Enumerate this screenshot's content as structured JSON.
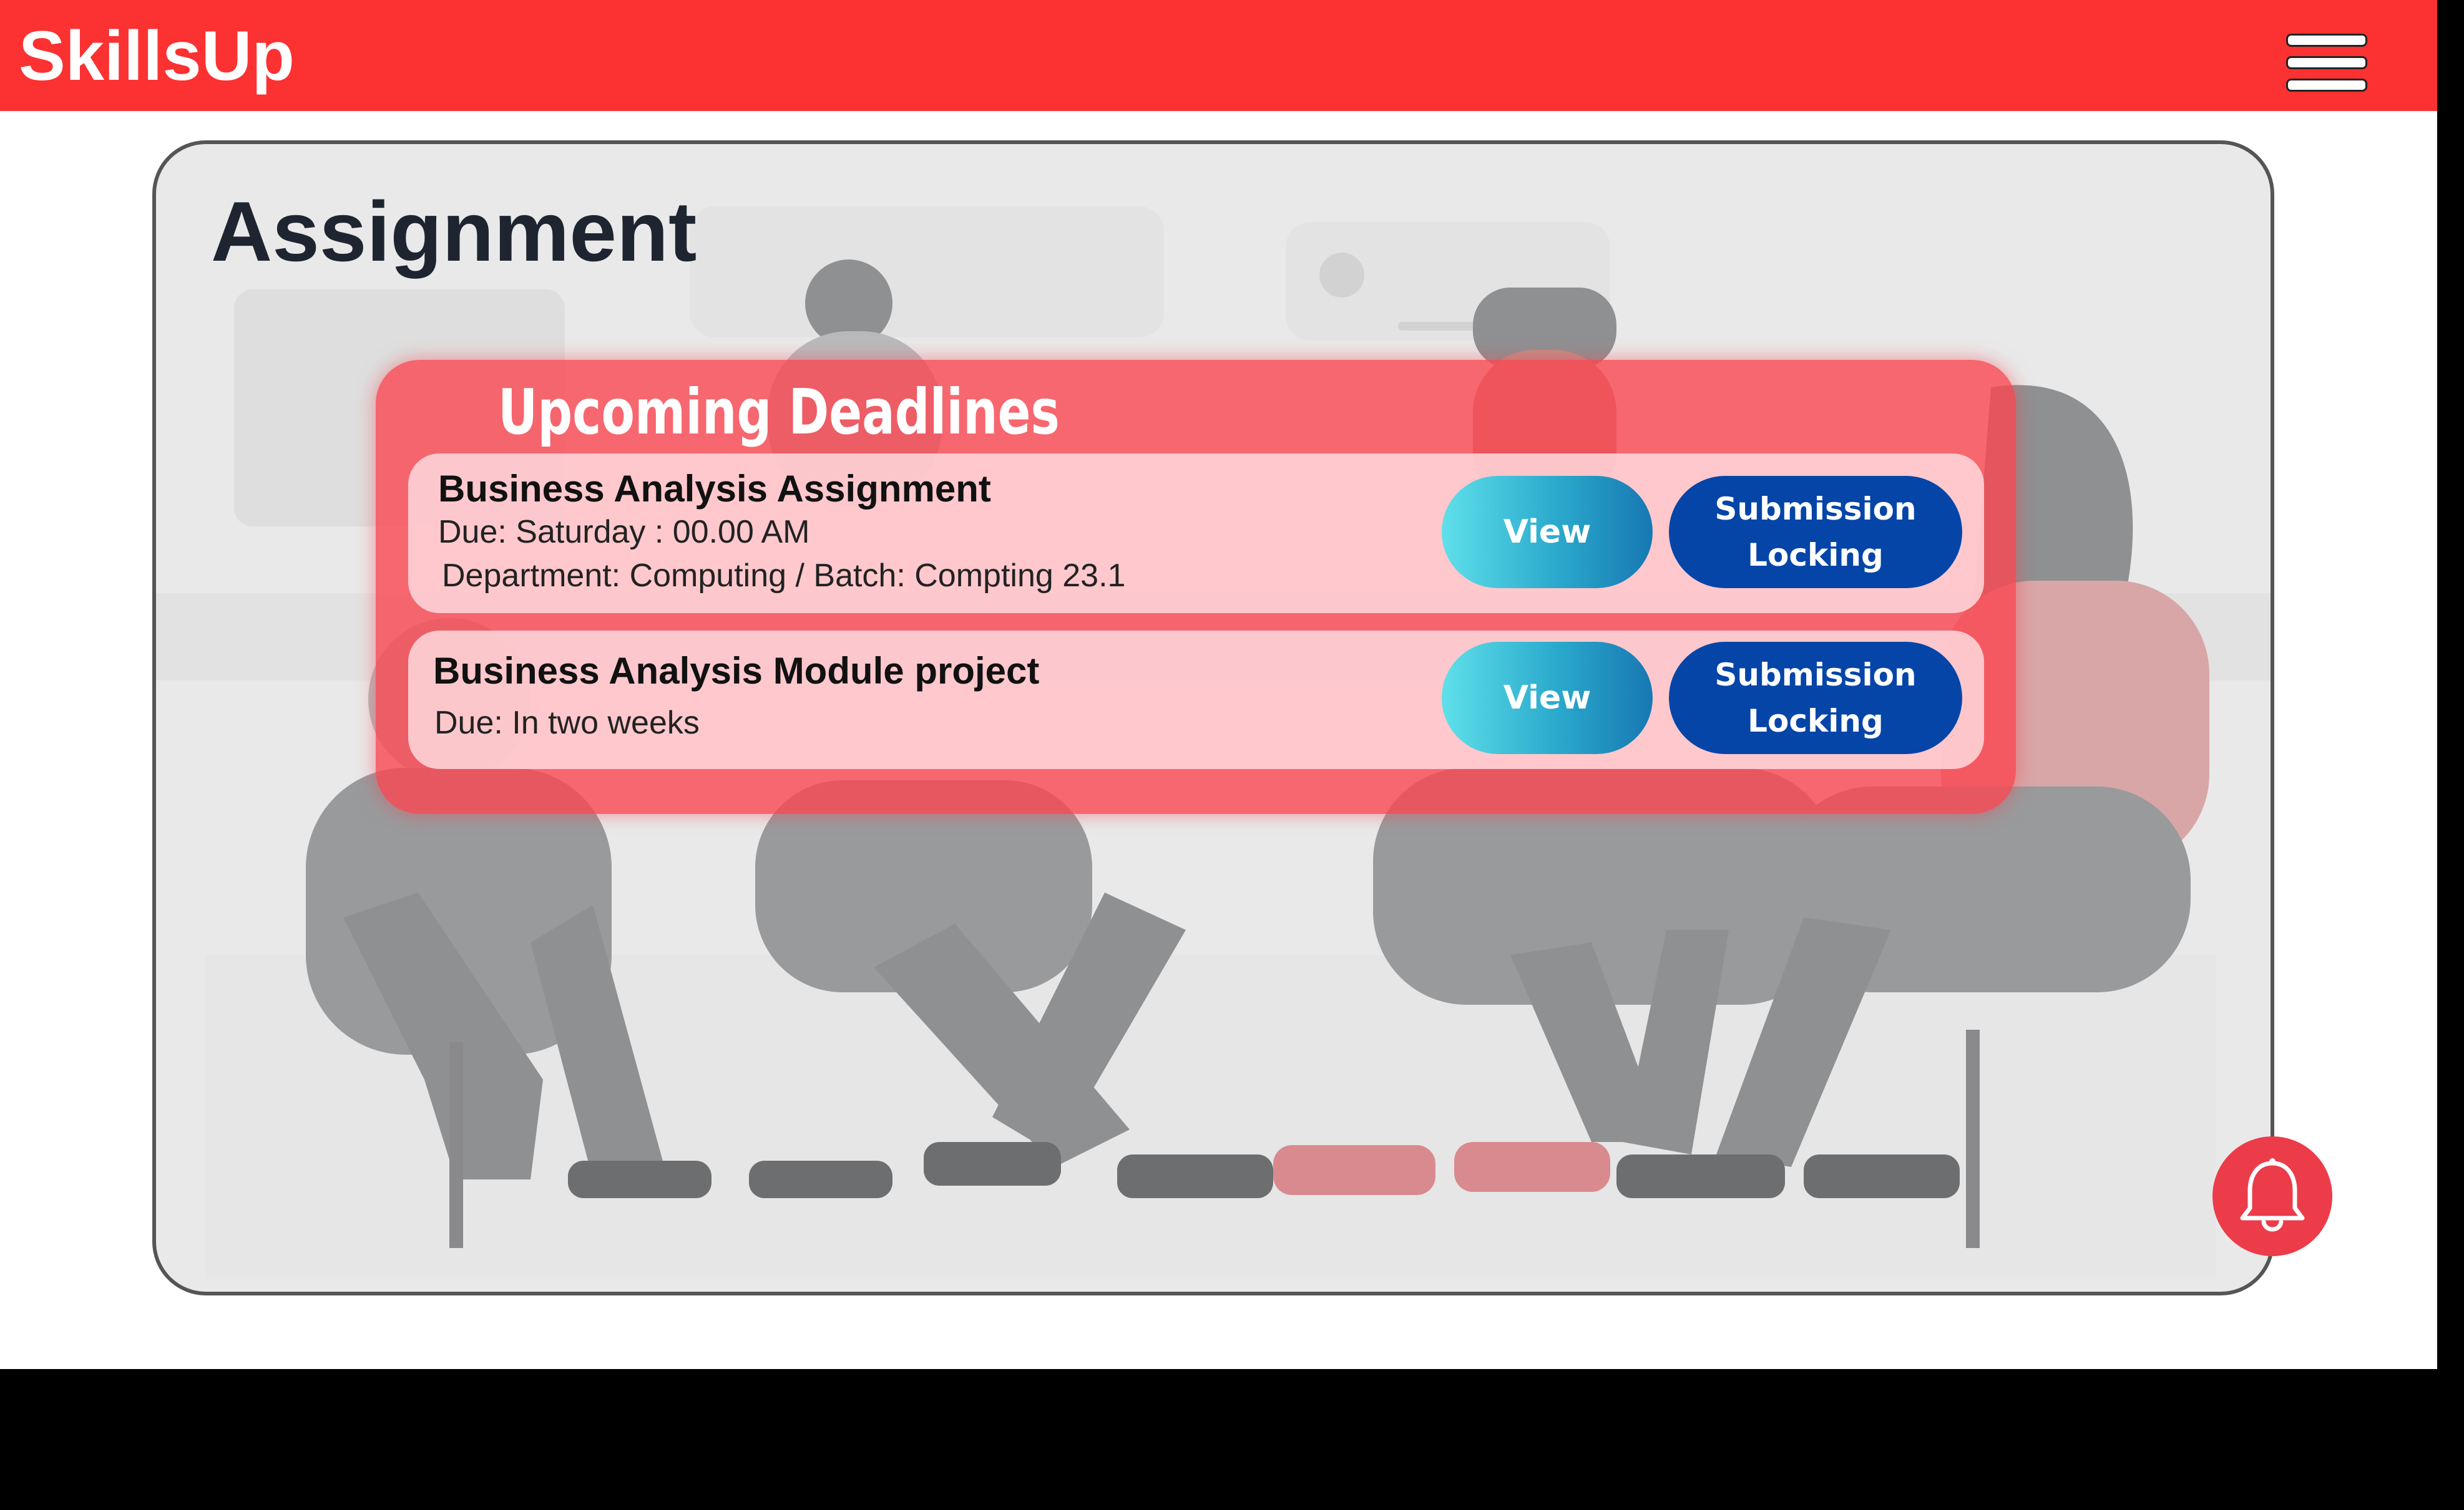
{
  "app": {
    "brand": "SkillsUp",
    "menu_icon": "hamburger-menu-icon"
  },
  "page": {
    "title": "Assignment"
  },
  "deadlines": {
    "title": "Upcoming Deadlines",
    "items": [
      {
        "name": "Business Analysis Assignment",
        "due": "Due: Saturday : 00.00 AM",
        "department": "Department: Computing / Batch: Compting 23.1",
        "view_label": "View",
        "lock_label_1": "Submission",
        "lock_label_2": "Locking"
      },
      {
        "name": "Business Analysis Module project",
        "due": "Due: In two weeks",
        "view_label": "View",
        "lock_label_1": "Submission",
        "lock_label_2": "Locking"
      }
    ]
  },
  "notifications": {
    "icon": "bell-icon"
  },
  "colors": {
    "header_red": "#fc3131",
    "panel_red": "#fa4650",
    "view_button_cyan": "#2aa9cc",
    "lock_button_blue": "#0545a8",
    "bell_button_red": "#ec3c4a",
    "title_dark": "#1f2530"
  }
}
